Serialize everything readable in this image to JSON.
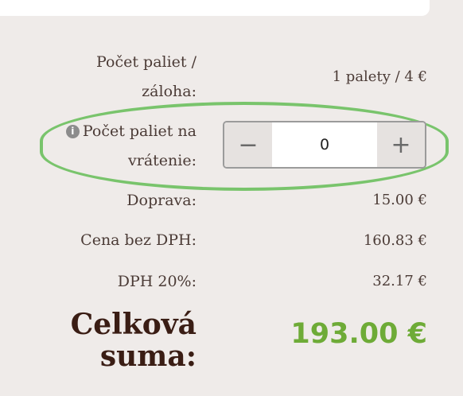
{
  "summary": {
    "pallets_label_line1": "Počet paliet /",
    "pallets_label_line2": "záloha:",
    "pallets_value": "1 palety / 4 €",
    "return_label_line1": "Počet paliet na",
    "return_label_line2": "vrátenie:",
    "return_stepper": {
      "minus": "−",
      "value": "0",
      "plus": "+"
    },
    "shipping_label": "Doprava:",
    "shipping_value": "15.00 €",
    "net_label": "Cena bez DPH:",
    "net_value": "160.83 €",
    "vat_label": "DPH 20%:",
    "vat_value": "32.17 €",
    "total_label_line1": "Celková",
    "total_label_line2": "suma:",
    "total_value": "193.00 €"
  },
  "icons": {
    "info": "info-icon"
  },
  "colors": {
    "highlight_ring": "#79c46c",
    "total_value": "#6eab37",
    "total_label": "#3a1d14",
    "background": "#efebe9"
  }
}
